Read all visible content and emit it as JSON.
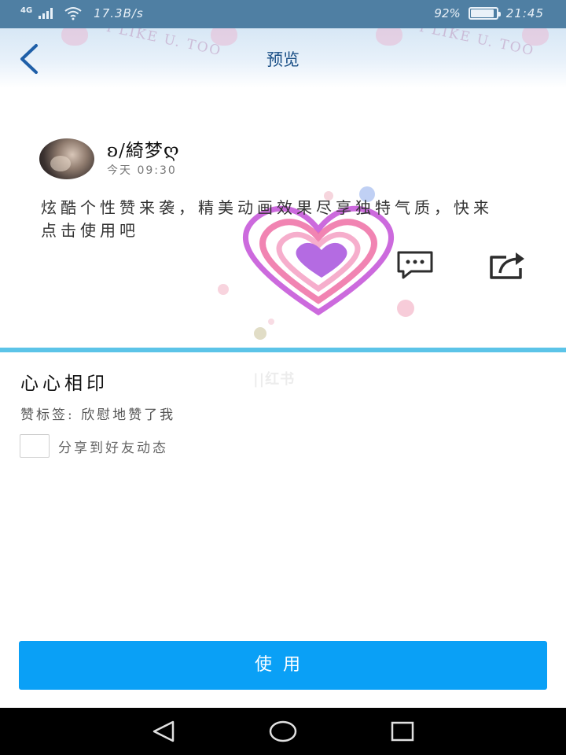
{
  "status_bar": {
    "network_type": "4G",
    "speed": "17.3B/s",
    "battery_percent": "92%",
    "battery_level": 0.92,
    "time": "21:45",
    "icons": [
      "signal-icon",
      "wifi-icon",
      "battery-icon"
    ]
  },
  "header": {
    "title": "预览",
    "banner_text": [
      "I LIKE U. TOO",
      "I LIKE U. TOO"
    ],
    "back_icon": "chevron-left-icon"
  },
  "post": {
    "username": "ʚ/綺梦ღ",
    "time": "今天 09:30",
    "content": "炫酷个性赞来袭，精美动画效果尽享独特气质，快来点击使用吧",
    "comment_icon": "comment-icon",
    "share_icon": "share-icon"
  },
  "effect": {
    "name": "心心相印",
    "watermark": "||红书",
    "tag_line": "赞标签: 欣慰地赞了我",
    "share_label": "分享到好友动态",
    "share_checked": false
  },
  "actions": {
    "use_label": "使用"
  },
  "nav_bar": {
    "icons": [
      "back-triangle-icon",
      "home-circle-icon",
      "recents-square-icon"
    ]
  },
  "colors": {
    "status_bar": "#4f7fa3",
    "title": "#1a4f86",
    "divider": "#5cc4e8",
    "primary_button": "#0aa0f6"
  }
}
